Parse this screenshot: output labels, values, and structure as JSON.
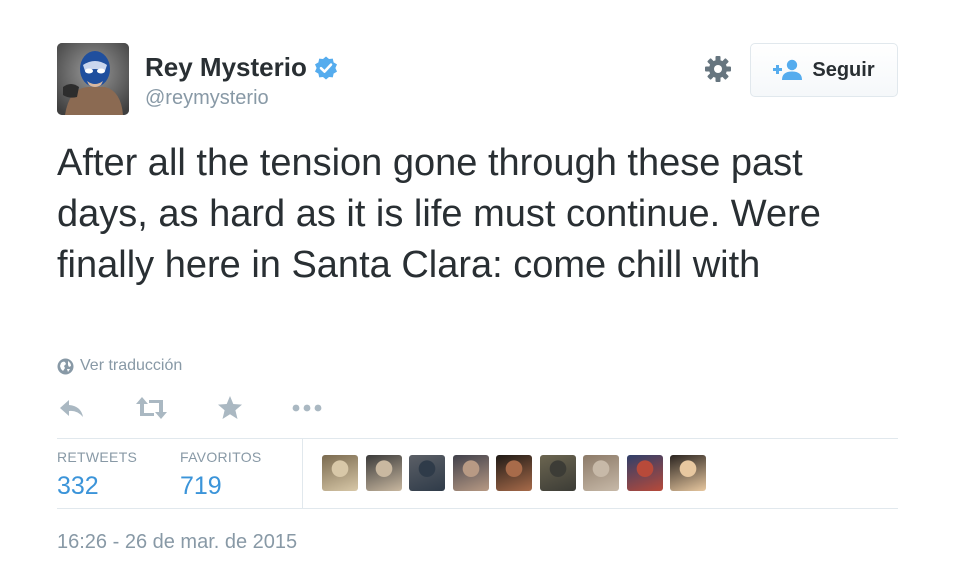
{
  "user": {
    "display_name": "Rey Mysterio",
    "screen_name": "@reymysterio",
    "verified": true
  },
  "follow_button": {
    "label": "Seguir"
  },
  "tweet": {
    "text": "After all the tension gone through these past days, as hard as it is life must continue. Were finally here in Santa Clara: come chill with",
    "translate_label": "Ver traducción",
    "timestamp": "16:26 - 26 de mar. de 2015"
  },
  "actions": [
    {
      "name": "reply-icon"
    },
    {
      "name": "retweet-icon"
    },
    {
      "name": "favorite-star-icon"
    },
    {
      "name": "more-dots-icon"
    }
  ],
  "stats": {
    "retweets_label": "RETWEETS",
    "retweets_count": "332",
    "favorites_label": "FAVORITOS",
    "favorites_count": "719"
  },
  "favoriters": [
    {
      "color_a": "#7a6a4f",
      "color_b": "#d8c8a8"
    },
    {
      "color_a": "#3a3a3a",
      "color_b": "#c9b8a0"
    },
    {
      "color_a": "#5b5f66",
      "color_b": "#2f3b49"
    },
    {
      "color_a": "#40404a",
      "color_b": "#b89a84"
    },
    {
      "color_a": "#1f1a16",
      "color_b": "#a86b4a"
    },
    {
      "color_a": "#6b6550",
      "color_b": "#3c3c36"
    },
    {
      "color_a": "#8c7a68",
      "color_b": "#c7b9a8"
    },
    {
      "color_a": "#2f3f6a",
      "color_b": "#b84a3a"
    },
    {
      "color_a": "#2a2420",
      "color_b": "#e8c8a0"
    }
  ],
  "colors": {
    "link": "#3b94d9",
    "muted": "#8899a6",
    "text": "#292f33",
    "verified": "#55acee"
  }
}
